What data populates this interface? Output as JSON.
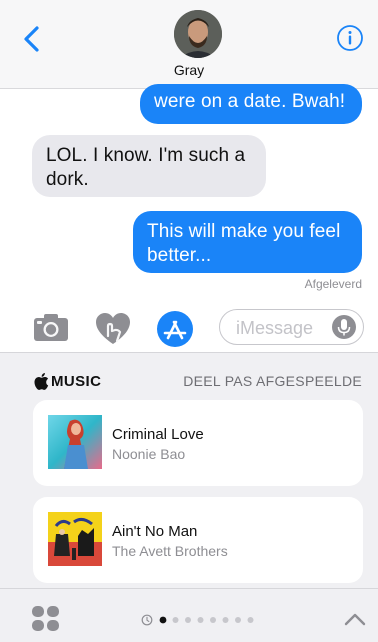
{
  "header": {
    "contact_name": "Gray"
  },
  "messages": [
    {
      "direction": "outgoing",
      "text": "were on a date. Bwah!"
    },
    {
      "direction": "incoming",
      "text": "LOL. I know. I'm such a dork."
    },
    {
      "direction": "outgoing",
      "text": "This will make you feel better..."
    }
  ],
  "status": {
    "delivered": "Afgeleverd"
  },
  "input_bar": {
    "placeholder": "iMessage"
  },
  "drawer": {
    "brand": "MUSIC",
    "share_recent": "DEEL PAS AFGESPEELDE",
    "songs": [
      {
        "title": "Criminal Love",
        "artist": "Noonie Bao"
      },
      {
        "title": "Ain't No Man",
        "artist": "The Avett Brothers"
      }
    ]
  },
  "bottom_bar": {
    "page_count": 8,
    "active_page": 1
  },
  "colors": {
    "accent": "#1a84f8",
    "incoming_bubble": "#e8e8ed",
    "drawer_background": "#f0f0f3"
  },
  "icons": [
    "chevron-left-icon",
    "info-icon",
    "camera-icon",
    "digital-touch-icon",
    "app-store-icon",
    "microphone-icon",
    "apple-logo-icon",
    "apps-grid-icon",
    "recent-clock-icon",
    "chevron-up-icon"
  ]
}
